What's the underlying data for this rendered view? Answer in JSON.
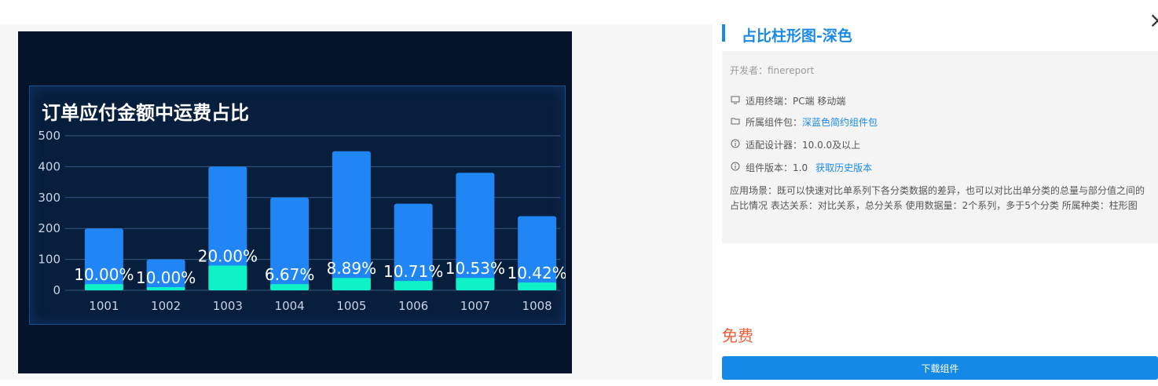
{
  "preview": {
    "chart_title": "订单应付金额中运费占比"
  },
  "chart_data": {
    "type": "bar",
    "title": "订单应付金额中运费占比",
    "categories": [
      "1001",
      "1002",
      "1003",
      "1004",
      "1005",
      "1006",
      "1007",
      "1008"
    ],
    "series": [
      {
        "values": [
          200,
          100,
          400,
          300,
          450,
          280,
          380,
          240
        ]
      },
      {
        "values": [
          20,
          10,
          80,
          20,
          40,
          30,
          40,
          25
        ]
      }
    ],
    "labels": [
      "10.00%",
      "10.00%",
      "20.00%",
      "6.67%",
      "8.89%",
      "10.71%",
      "10.53%",
      "10.42%"
    ],
    "ylim": [
      0,
      500
    ],
    "yticks": [
      0,
      100,
      200,
      300,
      400,
      500
    ],
    "grid": true,
    "colors": {
      "total": "#2186f5",
      "part": "#0ff2c8",
      "label": "#ffffff",
      "axis": "#c8d4e6",
      "grid": "#3a5a82"
    }
  },
  "detail": {
    "title": "占比柱形图-深色",
    "close": "×",
    "developer": "开发者：finereport",
    "terminal": "适用终端：PC端  移动端",
    "package_prefix": "所属组件包：",
    "package_name": "深蓝色简约组件包",
    "designer": "适配设计器：10.0.0及以上",
    "version": "组件版本：1.0",
    "history_link": "获取历史版本",
    "description": "应用场景：既可以快速对比单系列下各分类数据的差异，也可以对比出单分类的总量与部分值之间的占比情况 表达关系：对比关系，总分关系 使用数据量：2个系列，多于5个分类 所属种类：柱形图",
    "price": "免费",
    "download": "下载组件"
  },
  "icons": {
    "terminal": "monitor-icon",
    "package": "folder-icon",
    "designer": "info-icon",
    "version": "info-icon"
  }
}
